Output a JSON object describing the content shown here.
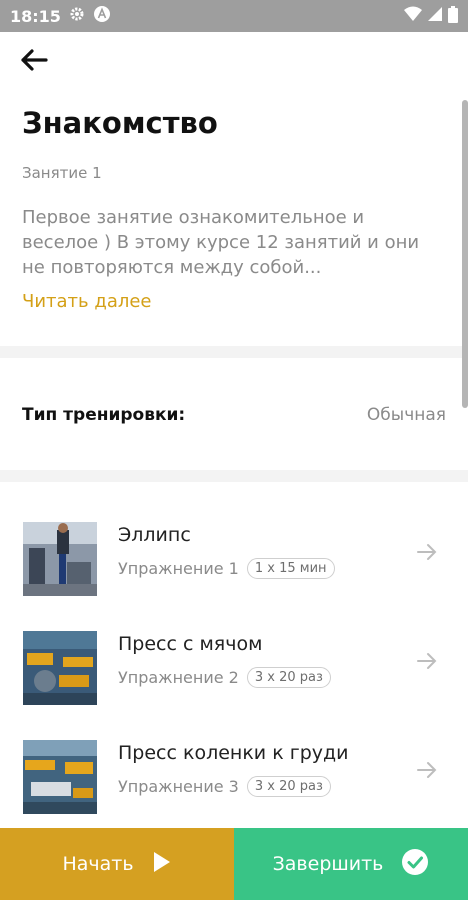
{
  "status_bar": {
    "time": "18:15",
    "icons": [
      "gear-icon",
      "a-badge-icon",
      "wifi-icon",
      "signal-icon",
      "battery-icon"
    ]
  },
  "header": {
    "title": "Знакомство",
    "lesson_number": "Занятие 1",
    "description": "Первое занятие ознакомительное и веселое ) В этому курсе 12 занятий и они не повторяются между собой...",
    "read_more": "Читать далее"
  },
  "training_type": {
    "label": "Тип тренировки:",
    "value": "Обычная"
  },
  "exercises": [
    {
      "name": "Эллипс",
      "number": "Упражнение 1",
      "badge": "1 x 15 мин"
    },
    {
      "name": "Пресс с мячом",
      "number": "Упражнение 2",
      "badge": "3 x 20 раз"
    },
    {
      "name": "Пресс коленки к груди",
      "number": "Упражнение 3",
      "badge": "3 x 20 раз"
    }
  ],
  "actions": {
    "start": "Начать",
    "finish": "Завершить"
  },
  "colors": {
    "accent_yellow": "#d5a021",
    "accent_green": "#39c486",
    "status_bar": "#9e9e9e"
  }
}
